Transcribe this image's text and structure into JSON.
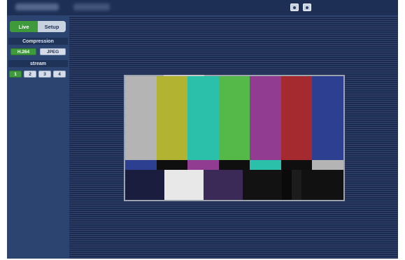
{
  "topbar": {
    "icons": [
      "snapshot-icon",
      "camera-icon"
    ]
  },
  "sidebar": {
    "tabs": [
      {
        "label": "Live",
        "active": true
      },
      {
        "label": "Setup",
        "active": false
      }
    ],
    "compression": {
      "title": "Compression",
      "options": [
        {
          "label": "H.264",
          "active": true
        },
        {
          "label": "JPEG",
          "active": false
        }
      ]
    },
    "stream": {
      "title": "stream",
      "options": [
        {
          "label": "1",
          "active": true
        },
        {
          "label": "2",
          "active": false
        },
        {
          "label": "3",
          "active": false
        },
        {
          "label": "4",
          "active": false
        }
      ]
    }
  },
  "colors": {
    "accent_green": "#3f9a3b",
    "panel_navy": "#2b4470",
    "background_navy": "#1c2f57",
    "color_bars_top": [
      "#b4b4b4",
      "#b2b431",
      "#2bc0a9",
      "#55b94a",
      "#913c91",
      "#a42a30",
      "#2c3f91"
    ],
    "color_bars_mid": [
      "#2c3f91",
      "#0f0f0f",
      "#913c91",
      "#0f0f0f",
      "#2bc0a9",
      "#0f0f0f",
      "#b4b4b4"
    ],
    "color_bars_bottom": [
      "#1b1d3f",
      "#e8e8e8",
      "#3b2a58",
      "#121212",
      "#0a0a0a",
      "#1c1c1c",
      "#111111"
    ]
  }
}
